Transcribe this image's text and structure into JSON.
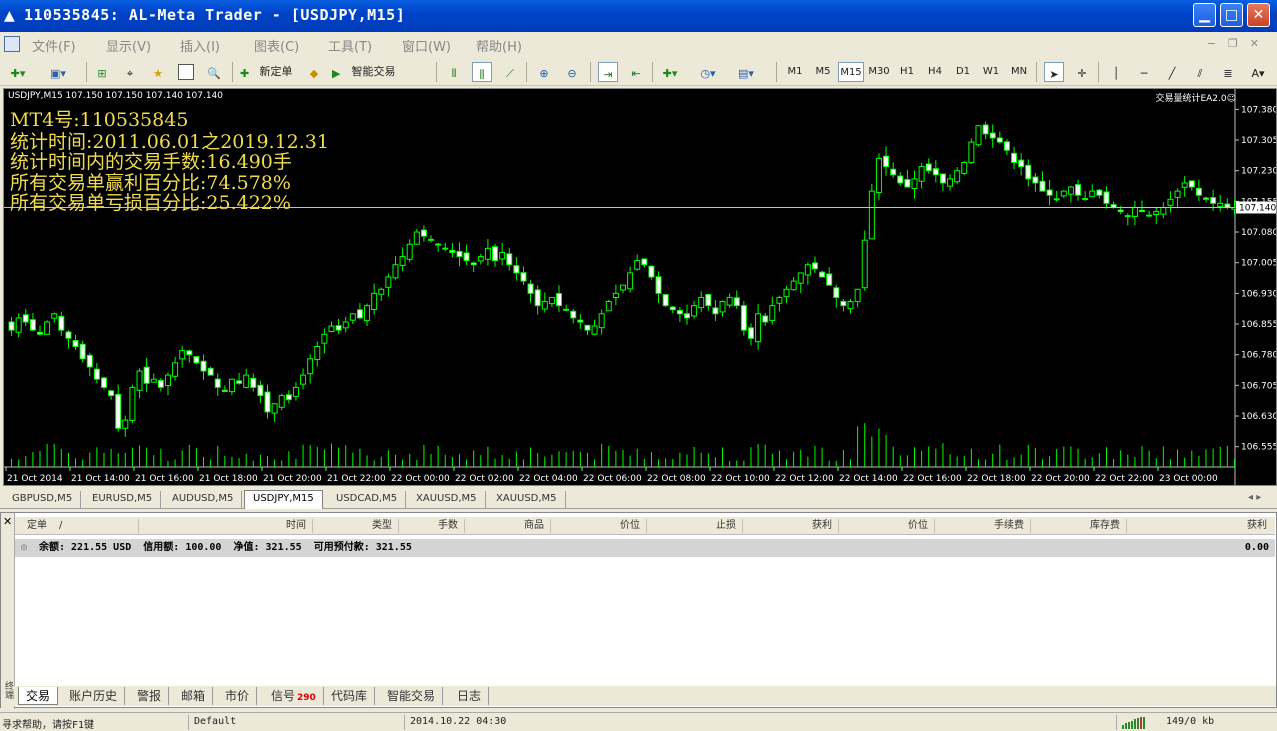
{
  "window": {
    "title": "110535845: AL-Meta Trader - [USDJPY,M15]"
  },
  "menu": [
    "文件(F)",
    "显示(V)",
    "插入(I)",
    "图表(C)",
    "工具(T)",
    "窗口(W)",
    "帮助(H)"
  ],
  "toolbar": {
    "new_order": "新定单",
    "expert_advisors": "智能交易",
    "timeframes": [
      "M1",
      "M5",
      "M15",
      "M30",
      "H1",
      "H4",
      "D1",
      "W1",
      "MN"
    ],
    "active_timeframe": "M15"
  },
  "chart": {
    "symbol_header": "USDJPY,M15  107.150 107.150 107.140 107.140",
    "ea_label": "交易量统计EA2.0☺",
    "current_price": "107.140",
    "stats": [
      "MT4号:110535845",
      "统计时间:2011.06.01之2019.12.31",
      "统计时间内的交易手数:16.490手",
      "所有交易单赢利百分比:74.578%",
      "所有交易单亏损百分比:25.422%"
    ],
    "colors": {
      "bull": "#00ff00",
      "bear": "#00ff00",
      "background": "#000000",
      "text": "#f0dc50",
      "price_line": "#c0c0c0"
    }
  },
  "chart_data": {
    "type": "candlestick",
    "title": "USDJPY,M15",
    "ylim": [
      106.52,
      107.42
    ],
    "y_ticks": [
      "107.380",
      "107.305",
      "107.230",
      "107.155",
      "107.080",
      "107.005",
      "106.930",
      "106.855",
      "106.780",
      "106.705",
      "106.630",
      "106.555"
    ],
    "x_ticks": [
      "21 Oct 2014",
      "21 Oct 14:00",
      "21 Oct 16:00",
      "21 Oct 18:00",
      "21 Oct 20:00",
      "21 Oct 22:00",
      "22 Oct 00:00",
      "22 Oct 02:00",
      "22 Oct 04:00",
      "22 Oct 06:00",
      "22 Oct 08:00",
      "22 Oct 10:00",
      "22 Oct 12:00",
      "22 Oct 14:00",
      "22 Oct 16:00",
      "22 Oct 18:00",
      "22 Oct 20:00",
      "22 Oct 22:00",
      "23 Oct 00:00"
    ],
    "close": [
      106.84,
      106.87,
      106.86,
      106.84,
      106.83,
      106.86,
      106.88,
      106.84,
      106.82,
      106.8,
      106.77,
      106.75,
      106.72,
      106.7,
      106.68,
      106.6,
      106.62,
      106.7,
      106.74,
      106.71,
      106.72,
      106.7,
      106.73,
      106.76,
      106.79,
      106.78,
      106.76,
      106.74,
      106.73,
      106.7,
      106.69,
      106.72,
      106.71,
      106.73,
      106.7,
      106.68,
      106.64,
      106.66,
      106.68,
      106.67,
      106.7,
      106.73,
      106.77,
      106.8,
      106.83,
      106.85,
      106.84,
      106.86,
      106.88,
      106.87,
      106.9,
      106.93,
      106.94,
      106.97,
      107.0,
      107.02,
      107.05,
      107.08,
      107.07,
      107.06,
      107.05,
      107.04,
      107.03,
      107.02,
      107.01,
      107.0,
      107.02,
      107.04,
      107.01,
      107.03,
      107.0,
      106.98,
      106.96,
      106.93,
      106.9,
      106.91,
      106.92,
      106.9,
      106.89,
      106.87,
      106.86,
      106.84,
      106.85,
      106.88,
      106.91,
      106.93,
      106.95,
      106.98,
      107.01,
      107.0,
      106.97,
      106.93,
      106.9,
      106.89,
      106.88,
      106.87,
      106.9,
      106.92,
      106.9,
      106.88,
      106.91,
      106.92,
      106.9,
      106.84,
      106.82,
      106.88,
      106.86,
      106.9,
      106.92,
      106.94,
      106.96,
      106.98,
      107.0,
      106.99,
      106.97,
      106.95,
      106.92,
      106.9,
      106.91,
      106.94,
      107.06,
      107.18,
      107.26,
      107.24,
      107.22,
      107.2,
      107.19,
      107.21,
      107.24,
      107.23,
      107.22,
      107.2,
      107.21,
      107.23,
      107.25,
      107.3,
      107.34,
      107.32,
      107.31,
      107.3,
      107.28,
      107.25,
      107.24,
      107.21,
      107.2,
      107.18,
      107.17,
      107.16,
      107.18,
      107.19,
      107.17,
      107.16,
      107.18,
      107.17,
      107.15,
      107.14,
      107.13,
      107.12,
      107.14,
      107.13,
      107.12,
      107.13,
      107.14,
      107.16,
      107.18,
      107.2,
      107.19,
      107.17,
      107.16,
      107.15,
      107.15,
      107.14,
      107.14
    ],
    "volume_note": "tick volume histogram at bottom"
  },
  "symbol_tabs": [
    "GBPUSD,M5",
    "EURUSD,M5",
    "AUDUSD,M5",
    "USDJPY,M15",
    "USDCAD,M5",
    "XAUUSD,M5",
    "XAUUSD,M5"
  ],
  "active_symbol_tab": "USDJPY,M15",
  "terminal": {
    "columns": [
      "定单",
      "/",
      "时间",
      "类型",
      "手数",
      "商品",
      "价位",
      "止损",
      "获利",
      "价位",
      "手续费",
      "库存费",
      "获利"
    ],
    "balance_row": "余额: 221.55 USD  信用额: 100.00  净值: 321.55  可用预付款: 321.55",
    "balance_profit": "0.00",
    "side_label": "终端",
    "tabs": [
      "交易",
      "账户历史",
      "警报",
      "邮箱",
      "市价",
      "信号",
      "代码库",
      "智能交易",
      "日志"
    ],
    "signal_badge": "290",
    "active_tab": "交易"
  },
  "status": {
    "help": "寻求帮助，请按F1键",
    "profile": "Default",
    "datetime": "2014.10.22 04:30",
    "traffic": "149/0 kb"
  }
}
